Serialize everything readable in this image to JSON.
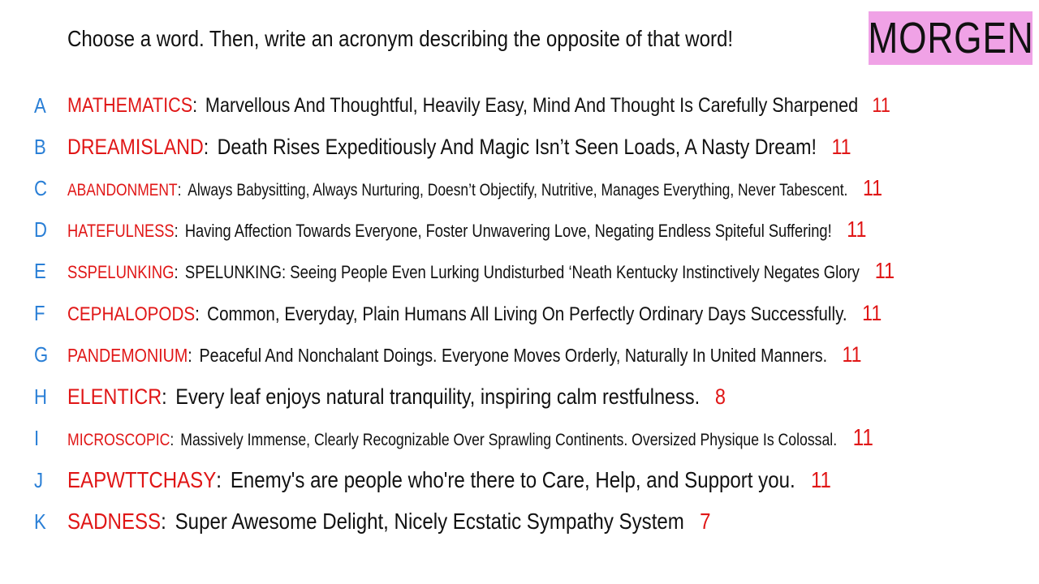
{
  "prompt": "Choose a word. Then, write an acronym describing the opposite of that word!",
  "badge": "MORGEN",
  "colors": {
    "word": "#e01616",
    "letter": "#2a7fd6",
    "badge_bg": "#f0a2e6",
    "text": "#111111"
  },
  "rows": [
    {
      "letter": "A",
      "word": "MATHEMATICS",
      "acronym": "Marvellous And Thoughtful, Heavily Easy, Mind And Thought Is Carefully Sharpened",
      "count": "11"
    },
    {
      "letter": "B",
      "word": "DREAMISLAND",
      "acronym": "Death Rises Expeditiously And Magic Isn’t Seen Loads, A Nasty Dream!",
      "count": "11"
    },
    {
      "letter": "C",
      "word": "ABANDONMENT",
      "acronym": "Always Babysitting, Always Nurturing, Doesn’t Objectify, Nutritive, Manages Everything, Never Tabescent.",
      "count": "11"
    },
    {
      "letter": "D",
      "word": "HATEFULNESS",
      "acronym": "Having Affection Towards Everyone, Foster Unwavering Love, Negating Endless Spiteful Suffering!",
      "count": "11"
    },
    {
      "letter": "E",
      "word": "SSPELUNKING",
      "acronym": "SPELUNKING: Seeing People Even Lurking Undisturbed ‘Neath Kentucky Instinctively Negates Glory",
      "count": "11"
    },
    {
      "letter": "F",
      "word": "CEPHALOPODS",
      "acronym": "Common, Everyday, Plain Humans All Living On Perfectly Ordinary Days Successfully.",
      "count": "11"
    },
    {
      "letter": "G",
      "word": "PANDEMONIUM",
      "acronym": "Peaceful And Nonchalant Doings. Everyone Moves Orderly, Naturally In United Manners.",
      "count": "11"
    },
    {
      "letter": "H",
      "word": "ELENTICR",
      "acronym": "Every leaf enjoys natural tranquility, inspiring calm restfulness.",
      "count": "8"
    },
    {
      "letter": "I",
      "word": "MICROSCOPIC",
      "acronym": "Massively Immense, Clearly Recognizable Over Sprawling Continents. Oversized Physique Is Colossal.",
      "count": "11"
    },
    {
      "letter": "J",
      "word": "EAPWTTCHASY",
      "acronym": "Enemy's are people who're there to Care, Help, and Support you.",
      "count": "11"
    },
    {
      "letter": "K",
      "word": "SADNESS",
      "acronym": "Super Awesome Delight, Nicely Ecstatic Sympathy System",
      "count": "7"
    }
  ]
}
